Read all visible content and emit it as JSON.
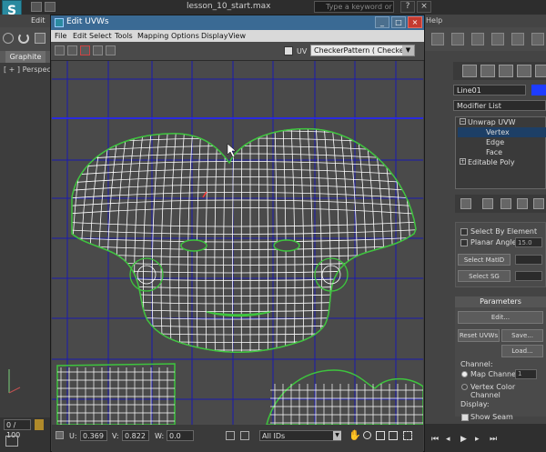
{
  "max": {
    "logo": "S",
    "title": "lesson_10_start.max",
    "search_placeholder": "Type a keyword or phrase",
    "menu_edit": "Edit",
    "menu_help": "Help",
    "graphite_tab": "Graphite",
    "viewport_label": "[ + ] Perspective",
    "frame_field": "0 / 100"
  },
  "uvw": {
    "title": "Edit UVWs",
    "menu": [
      "File",
      "Edit",
      "Select",
      "Tools",
      "Mapping",
      "Options",
      "Display",
      "View"
    ],
    "map_label": "UV",
    "map_dropdown": "CheckerPattern  ( Checker )",
    "u_label": "U:",
    "u_value": "0.369",
    "v_label": "V:",
    "v_value": "0.822",
    "w_label": "W:",
    "w_value": "0.0",
    "ids_dropdown": "All IDs"
  },
  "panel": {
    "object_name": "Line01",
    "object_color": "#1e3cff",
    "modifier_list": "Modifier List",
    "stack": [
      "Unwrap UVW",
      "Vertex",
      "Edge",
      "Face",
      "Editable Poly"
    ],
    "select_by_element": "Select By Element",
    "planar_angle": "Planar Angle",
    "planar_angle_value": "15.0",
    "select_matid": "Select MatID",
    "select_sg": "Select SG",
    "parameters_header": "Parameters",
    "edit_button": "Edit...",
    "reset_uvws": "Reset UVWs",
    "save_button": "Save...",
    "load_button": "Load...",
    "channel_label": "Channel:",
    "map_channel": "Map Channel:",
    "map_channel_value": "1",
    "vertex_color_channel": "Vertex Color Channel",
    "display_label": "Display:",
    "show_seam": "Show Seam"
  },
  "colors": {
    "viewport_bg": "#4a4a4a",
    "grid_blue": "#1a1ab0",
    "mesh_white": "#ffffff",
    "seam_green": "#3ec43e",
    "titlebar_blue": "#3a6a94",
    "selection_blue": "#1d3f66"
  }
}
